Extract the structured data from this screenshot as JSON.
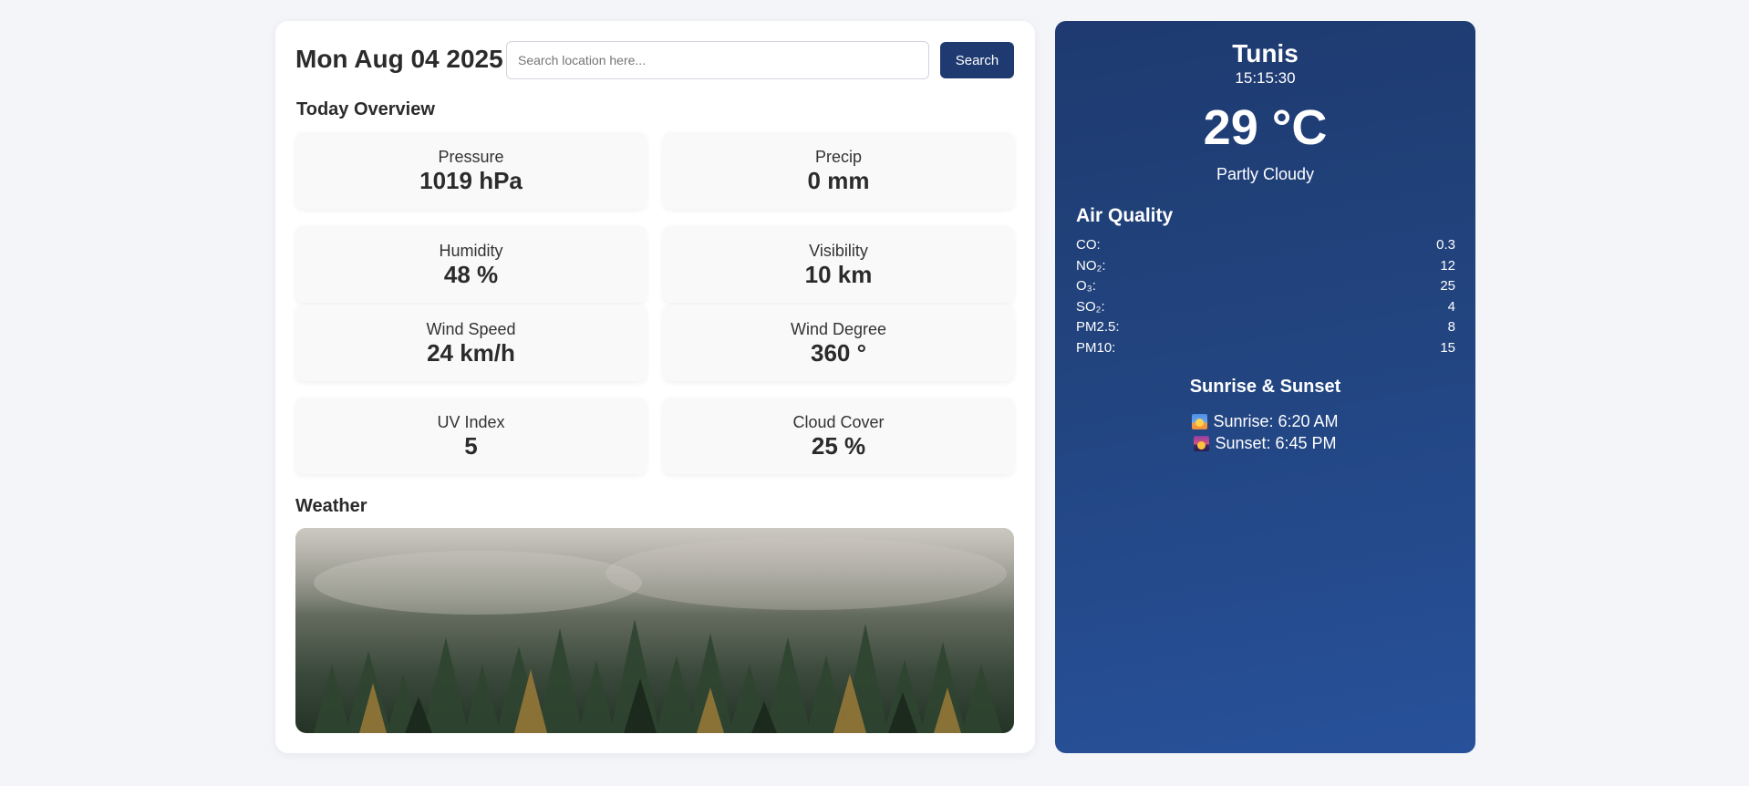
{
  "header": {
    "date": "Mon Aug 04 2025",
    "search_placeholder": "Search location here...",
    "search_value": "",
    "search_label": "Search"
  },
  "overview": {
    "title": "Today Overview",
    "metrics": [
      {
        "label": "Pressure",
        "value": "1019 hPa"
      },
      {
        "label": "Precip",
        "value": "0 mm"
      },
      {
        "label": "Humidity",
        "value": "48 %"
      },
      {
        "label": "Visibility",
        "value": "10 km"
      },
      {
        "label": "Wind Speed",
        "value": "24 km/h"
      },
      {
        "label": "Wind Degree",
        "value": "360 °"
      },
      {
        "label": "UV Index",
        "value": "5"
      },
      {
        "label": "Cloud Cover",
        "value": "25 %"
      }
    ]
  },
  "weather_section": {
    "title": "Weather",
    "image": "misty-forest-image"
  },
  "current": {
    "city": "Tunis",
    "time": "15:15:30",
    "temperature": "29 °C",
    "condition": "Partly Cloudy"
  },
  "air_quality": {
    "title": "Air Quality",
    "items": [
      {
        "label": "CO:",
        "value": "0.3"
      },
      {
        "label": "NO₂:",
        "value": "12"
      },
      {
        "label": "O₃:",
        "value": "25"
      },
      {
        "label": "SO₂:",
        "value": "4"
      },
      {
        "label": "PM2.5:",
        "value": "8"
      },
      {
        "label": "PM10:",
        "value": "15"
      }
    ]
  },
  "sun": {
    "title": "Sunrise & Sunset",
    "sunrise_icon": "sunrise-icon",
    "sunrise": "Sunrise: 6:20 AM",
    "sunset_icon": "sunset-icon",
    "sunset": "Sunset: 6:45 PM"
  },
  "colors": {
    "accent": "#1e3a70",
    "panel_top": "#1e3a70",
    "panel_bottom": "#27519a",
    "page_bg": "#f3f5f9"
  }
}
